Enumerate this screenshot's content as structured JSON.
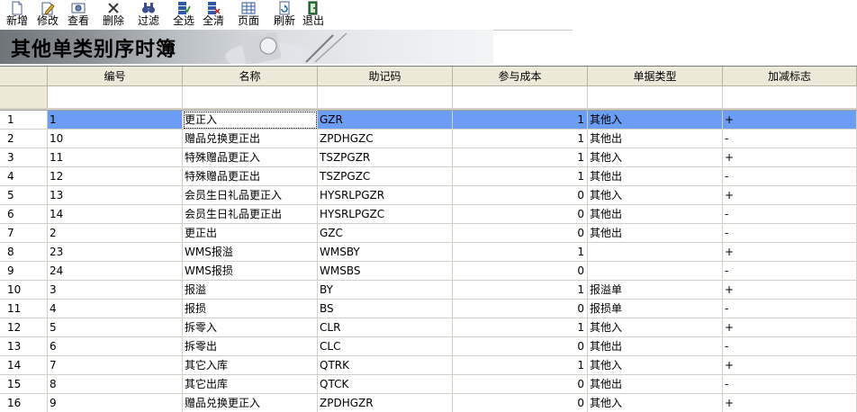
{
  "toolbar": {
    "buttons": [
      {
        "label": "新增",
        "icon": "new-document-icon"
      },
      {
        "label": "修改",
        "icon": "edit-document-icon"
      },
      {
        "label": "查看",
        "icon": "view-icon"
      },
      {
        "label": "删除",
        "icon": "delete-x-icon"
      },
      {
        "label": "过滤",
        "icon": "binoculars-icon"
      },
      {
        "label": "全选",
        "icon": "select-all-icon"
      },
      {
        "label": "全清",
        "icon": "clear-all-icon"
      },
      {
        "label": "页面",
        "icon": "page-grid-icon"
      },
      {
        "label": "刷新",
        "icon": "refresh-icon"
      },
      {
        "label": "退出",
        "icon": "exit-door-icon"
      }
    ]
  },
  "page": {
    "title": "其他单类别序时簿"
  },
  "grid": {
    "columns": [
      "编号",
      "名称",
      "助记码",
      "参与成本",
      "单据类型",
      "加减标志"
    ],
    "selected_row": 1,
    "colors": {
      "selection": "#6b9df5",
      "header": "#ece9d8"
    },
    "rows": [
      {
        "idx": "1",
        "code": "1",
        "name": "更正入",
        "mnemonic": "GZR",
        "cost": "1",
        "type": "其他入",
        "sign": "+"
      },
      {
        "idx": "2",
        "code": "10",
        "name": "赠品兑换更正出",
        "mnemonic": "ZPDHGZC",
        "cost": "1",
        "type": "其他出",
        "sign": "-"
      },
      {
        "idx": "3",
        "code": "11",
        "name": "特殊赠品更正入",
        "mnemonic": "TSZPGZR",
        "cost": "1",
        "type": "其他入",
        "sign": "+"
      },
      {
        "idx": "4",
        "code": "12",
        "name": "特殊赠品更正出",
        "mnemonic": "TSZPGZC",
        "cost": "1",
        "type": "其他出",
        "sign": "-"
      },
      {
        "idx": "5",
        "code": "13",
        "name": "会员生日礼品更正入",
        "mnemonic": "HYSRLPGZR",
        "cost": "0",
        "type": "其他入",
        "sign": "+"
      },
      {
        "idx": "6",
        "code": "14",
        "name": "会员生日礼品更正出",
        "mnemonic": "HYSRLPGZC",
        "cost": "0",
        "type": "其他出",
        "sign": "-"
      },
      {
        "idx": "7",
        "code": "2",
        "name": "更正出",
        "mnemonic": "GZC",
        "cost": "0",
        "type": "其他出",
        "sign": "-"
      },
      {
        "idx": "8",
        "code": "23",
        "name": "WMS报溢",
        "mnemonic": "WMSBY",
        "cost": "1",
        "type": "",
        "sign": "+"
      },
      {
        "idx": "9",
        "code": "24",
        "name": "WMS报损",
        "mnemonic": "WMSBS",
        "cost": "0",
        "type": "",
        "sign": "-"
      },
      {
        "idx": "10",
        "code": "3",
        "name": "报溢",
        "mnemonic": "BY",
        "cost": "1",
        "type": "报溢单",
        "sign": "+"
      },
      {
        "idx": "11",
        "code": "4",
        "name": "报损",
        "mnemonic": "BS",
        "cost": "0",
        "type": "报损单",
        "sign": "-"
      },
      {
        "idx": "12",
        "code": "5",
        "name": "拆零入",
        "mnemonic": "CLR",
        "cost": "1",
        "type": "其他入",
        "sign": "+"
      },
      {
        "idx": "13",
        "code": "6",
        "name": "拆零出",
        "mnemonic": "CLC",
        "cost": "0",
        "type": "其他出",
        "sign": "-"
      },
      {
        "idx": "14",
        "code": "7",
        "name": "其它入库",
        "mnemonic": "QTRK",
        "cost": "1",
        "type": "其他入",
        "sign": "+"
      },
      {
        "idx": "15",
        "code": "8",
        "name": "其它出库",
        "mnemonic": "QTCK",
        "cost": "0",
        "type": "其他出",
        "sign": "-"
      },
      {
        "idx": "16",
        "code": "9",
        "name": "赠品兑换更正入",
        "mnemonic": "ZPDHGZR",
        "cost": "0",
        "type": "其他入",
        "sign": "+"
      }
    ]
  }
}
